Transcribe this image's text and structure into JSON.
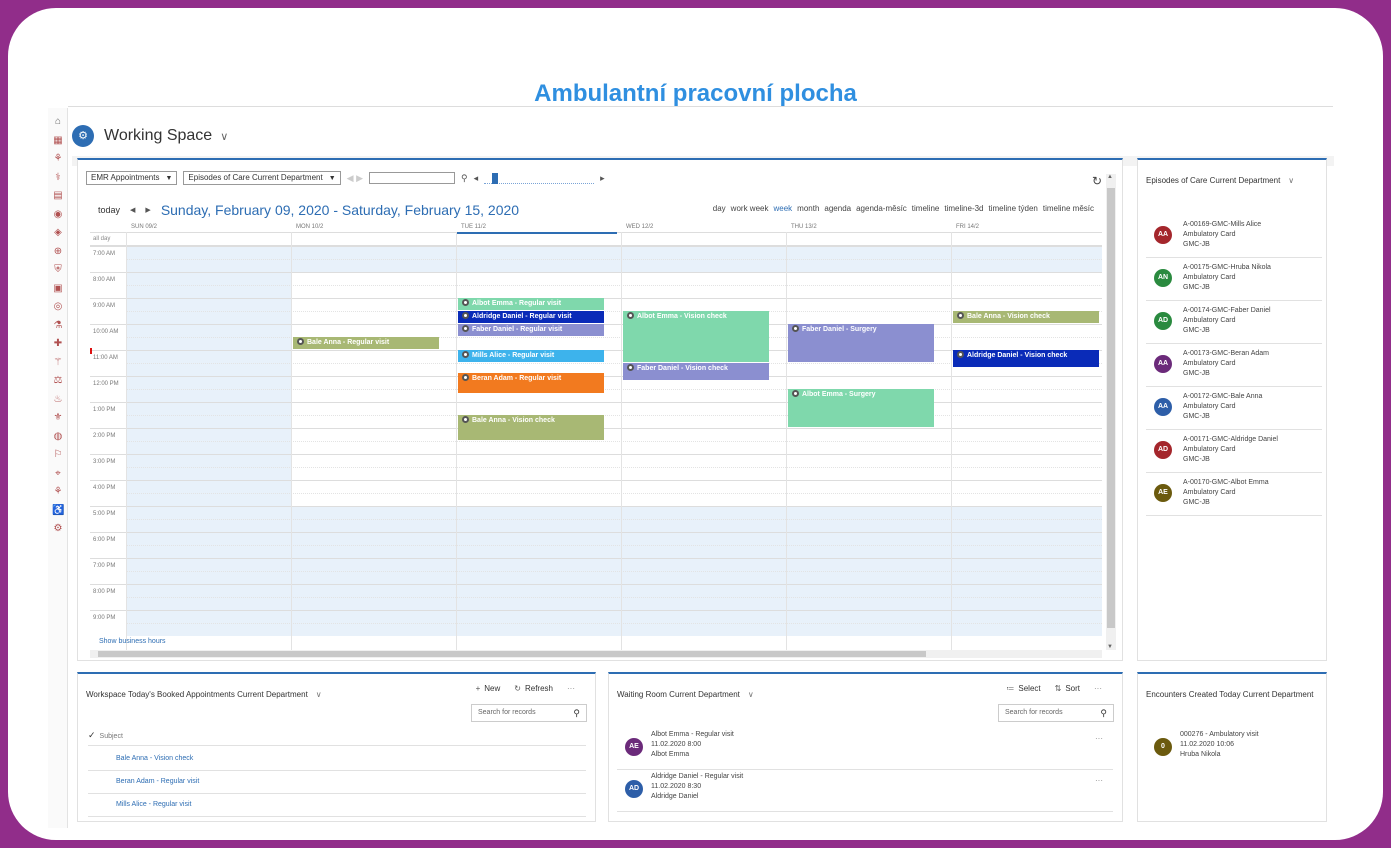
{
  "title": "Ambulantní pracovní plocha",
  "workspace": {
    "logo": "⚙",
    "title": "Working Space",
    "chevron": "∨"
  },
  "calendar": {
    "view_select": "EMR Appointments",
    "source_select": "Episodes of Care Current Department",
    "today": "today",
    "prev": "◀",
    "next": "▶",
    "range": "Sunday, February 09, 2020 - Saturday, February 15, 2020",
    "views": [
      "day",
      "work week",
      "week",
      "month",
      "agenda",
      "agenda-měsíc",
      "timeline",
      "timeline-3d",
      "timeline týden",
      "timeline měsíc"
    ],
    "active_view": "week",
    "days": [
      "SUN 09/2",
      "MON 10/2",
      "TUE 11/2",
      "WED 12/2",
      "THU 13/2",
      "FRI 14/2"
    ],
    "allday": "all day",
    "hours": [
      "7:00 AM",
      "8:00 AM",
      "9:00 AM",
      "10:00 AM",
      "11:00 AM",
      "12:00 PM",
      "1:00 PM",
      "2:00 PM",
      "3:00 PM",
      "4:00 PM",
      "5:00 PM",
      "6:00 PM",
      "7:00 PM",
      "8:00 PM",
      "9:00 PM"
    ],
    "events": [
      {
        "label": "Albot Emma - Regular visit",
        "color": "#7fd8ac"
      },
      {
        "label": "Aldridge Daniel - Regular visit",
        "color": "#0a2bb8"
      },
      {
        "label": "Faber Daniel - Regular visit",
        "color": "#8b8fd0"
      },
      {
        "label": "Mills Alice - Regular visit",
        "color": "#3db3ec"
      },
      {
        "label": "Beran Adam - Regular visit",
        "color": "#f27a1f"
      },
      {
        "label": "Bale Anna - Vision check",
        "color": "#a8b874"
      },
      {
        "label": "Bale Anna - Regular visit",
        "color": "#a8b874"
      },
      {
        "label": "Albot Emma - Vision check",
        "color": "#7fd8ac"
      },
      {
        "label": "Faber Daniel - Vision check",
        "color": "#8b8fd0"
      },
      {
        "label": "Faber Daniel - Surgery",
        "color": "#8b8fd0"
      },
      {
        "label": "Albot Emma - Surgery",
        "color": "#7fd8ac"
      },
      {
        "label": "Bale Anna - Vision check",
        "color": "#a8b874"
      },
      {
        "label": "Aldridge Daniel - Vision check",
        "color": "#0a2bb8"
      }
    ],
    "show_business_hours": "Show business hours"
  },
  "episodes": {
    "title": "Episodes of Care Current Department",
    "items": [
      {
        "initials": "AA",
        "color": "#a4262c",
        "id": "A-00169-GMC-Mills Alice",
        "type": "Ambulatory Card",
        "code": "GMC-JB"
      },
      {
        "initials": "AN",
        "color": "#2a8a3f",
        "id": "A-00175-GMC-Hruba Nikola",
        "type": "Ambulatory Card",
        "code": "GMC-JB"
      },
      {
        "initials": "AD",
        "color": "#2a8a3f",
        "id": "A-00174-GMC-Faber Daniel",
        "type": "Ambulatory Card",
        "code": "GMC-JB"
      },
      {
        "initials": "AA",
        "color": "#6b2a7a",
        "id": "A-00173-GMC-Beran Adam",
        "type": "Ambulatory Card",
        "code": "GMC-JB"
      },
      {
        "initials": "AA",
        "color": "#2d5ea8",
        "id": "A-00172-GMC-Bale Anna",
        "type": "Ambulatory Card",
        "code": "GMC-JB"
      },
      {
        "initials": "AD",
        "color": "#a4262c",
        "id": "A-00171-GMC-Aldridge Daniel",
        "type": "Ambulatory Card",
        "code": "GMC-JB"
      },
      {
        "initials": "AE",
        "color": "#6b5a0e",
        "id": "A-00170-GMC-Albot Emma",
        "type": "Ambulatory Card",
        "code": "GMC-JB"
      }
    ]
  },
  "booked": {
    "title": "Workspace Today's Booked Appointments Current Department",
    "new_label": "New",
    "refresh_label": "Refresh",
    "more": "···",
    "search_placeholder": "Search for records",
    "column": "Subject",
    "rows": [
      "Bale Anna - Vision check",
      "Beran Adam - Regular visit",
      "Mills Alice - Regular visit"
    ]
  },
  "waiting": {
    "title": "Waiting Room Current Department",
    "select_label": "Select",
    "sort_label": "Sort",
    "more": "···",
    "search_placeholder": "Search for records",
    "items": [
      {
        "initials": "AE",
        "color": "#6b2a7a",
        "subject": "Albot Emma - Regular visit",
        "time": "11.02.2020 8:00",
        "name": "Albot Emma"
      },
      {
        "initials": "AD",
        "color": "#2d5ea8",
        "subject": "Aldridge Daniel - Regular visit",
        "time": "11.02.2020 8:30",
        "name": "Aldridge Daniel"
      }
    ]
  },
  "encounters": {
    "title": "Encounters Created Today Current Department",
    "items": [
      {
        "initials": "0",
        "color": "#6b5a0e",
        "subject": "000276 - Ambulatory visit",
        "time": "11.02.2020 10:06",
        "name": "Hruba Nikola"
      }
    ]
  }
}
